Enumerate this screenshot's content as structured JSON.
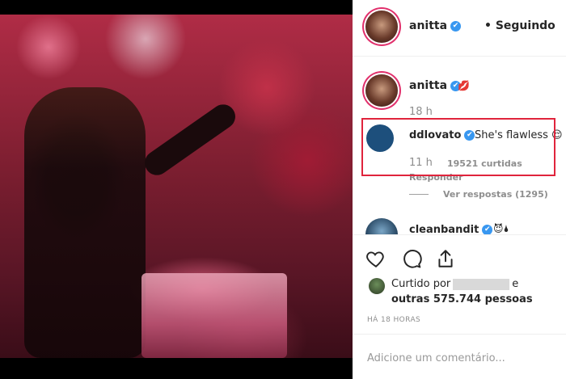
{
  "post": {
    "image_alt": "photo"
  },
  "header": {
    "username": "anitta",
    "verified_glyph": "✔",
    "separator": "•",
    "follow_label": "Seguindo"
  },
  "comments": [
    {
      "username": "anitta",
      "verified_glyph": "✔",
      "text": "💋",
      "time": "18 h"
    },
    {
      "username": "ddlovato",
      "verified_glyph": "✔",
      "text": "She's flawless 😌",
      "time": "11 h",
      "likes": "19521 curtidas",
      "reply_label": "Responder",
      "view_replies": "Ver respostas (1295)"
    },
    {
      "username": "cleanbandit",
      "verified_glyph": "✔",
      "text": "😈🌢"
    }
  ],
  "actions": {
    "like_icon": "heart-icon",
    "comment_icon": "comment-icon",
    "share_icon": "share-icon"
  },
  "likes": {
    "prefix": "Curtido por",
    "suffix": "e",
    "others": "outras 575.744 pessoas"
  },
  "timestamp": "HÁ 18 HORAS",
  "comment_input": {
    "placeholder": "Adicione um comentário..."
  }
}
